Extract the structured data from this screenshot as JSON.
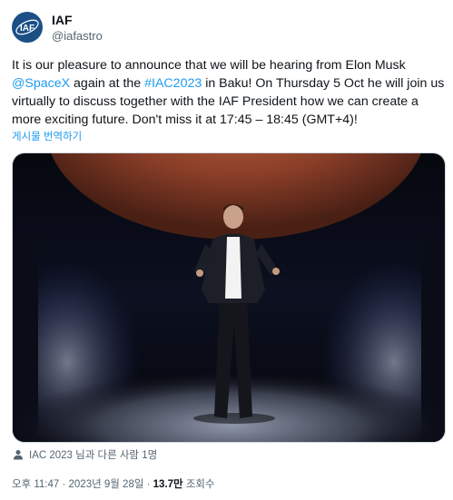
{
  "author": {
    "name": "IAF",
    "handle": "@iafastro",
    "logo_text": "IAF"
  },
  "tweet": {
    "text_1": "It is our pleasure to announce that we will be hearing from Elon Musk",
    "mention": "@SpaceX",
    "text_2": " again at the ",
    "hashtag": "#IAC2023",
    "text_3": " in Baku! On Thursday 5 Oct he will join us virtually to discuss together with the IAF President how we can create a more exciting future. Don't miss it at 17:45 – 18:45 (GMT+4)!",
    "translate_label": "게시물 번역하기"
  },
  "media": {
    "tagged_text": "IAC 2023 님과 다른 사람 1명"
  },
  "meta": {
    "time": "오후 11:47",
    "separator": " · ",
    "date": "2023년 9월 28일",
    "views_count": "13.7만",
    "views_label": " 조회수"
  },
  "colors": {
    "link": "#1d9bf0",
    "secondary_text": "#536471",
    "logo_bg": "#1b4f86"
  }
}
